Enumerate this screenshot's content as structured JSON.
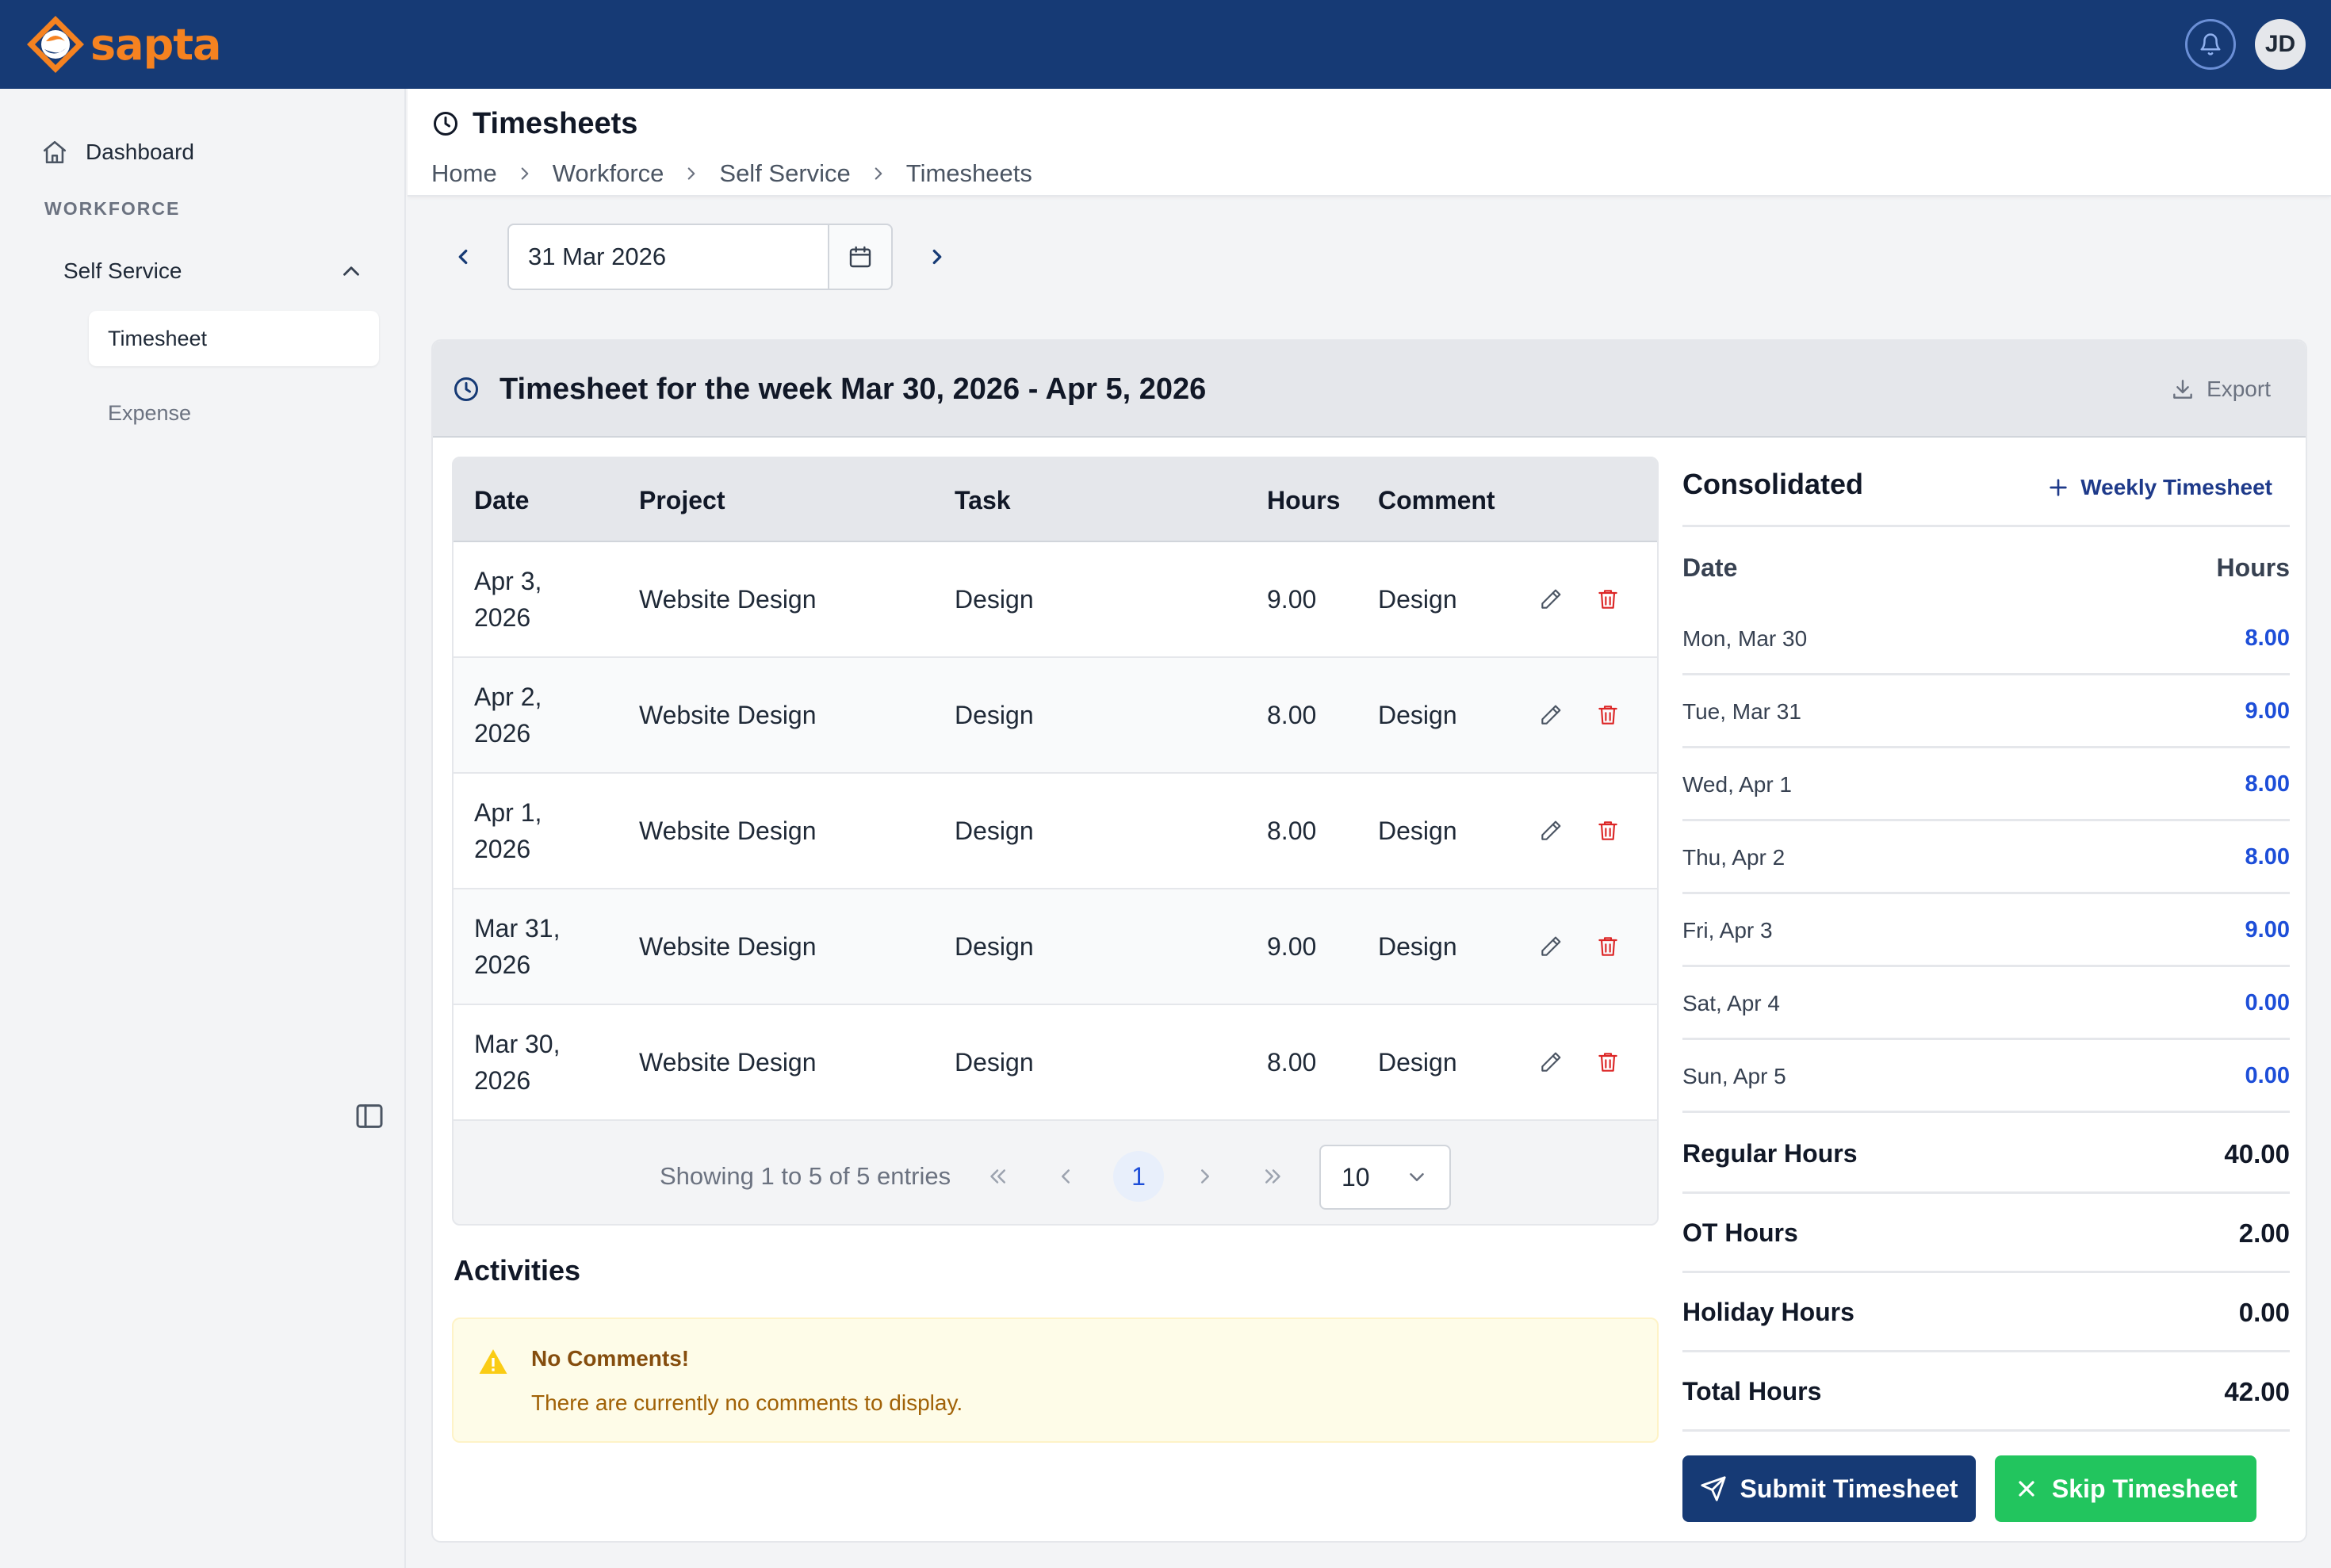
{
  "app": {
    "brand": "sapta",
    "user_initials": "JD"
  },
  "colors": {
    "topbar": "#163a75",
    "brand_orange": "#f58220",
    "link_blue": "#1d4ed8",
    "submit": "#163a75",
    "skip": "#22c55e",
    "danger": "#dc2626"
  },
  "sidebar": {
    "dashboard_label": "Dashboard",
    "section_label": "WORKFORCE",
    "group_label": "Self Service",
    "items": [
      {
        "label": "Timesheet",
        "active": true
      },
      {
        "label": "Expense",
        "active": false
      }
    ]
  },
  "header": {
    "title": "Timesheets",
    "breadcrumb": [
      "Home",
      "Workforce",
      "Self Service",
      "Timesheets"
    ]
  },
  "date_nav": {
    "value": "31 Mar 2026"
  },
  "card": {
    "title": "Timesheet for the week Mar 30, 2026 - Apr 5, 2026",
    "export_label": "Export"
  },
  "table": {
    "columns": [
      "Date",
      "Project",
      "Task",
      "Hours",
      "Comment"
    ],
    "rows": [
      {
        "date_line1": "Apr 3,",
        "date_line2": "2026",
        "project": "Website Design",
        "task": "Design",
        "hours": "9.00",
        "comment": "Design"
      },
      {
        "date_line1": "Apr 2,",
        "date_line2": "2026",
        "project": "Website Design",
        "task": "Design",
        "hours": "8.00",
        "comment": "Design"
      },
      {
        "date_line1": "Apr 1,",
        "date_line2": "2026",
        "project": "Website Design",
        "task": "Design",
        "hours": "8.00",
        "comment": "Design"
      },
      {
        "date_line1": "Mar 31,",
        "date_line2": "2026",
        "project": "Website Design",
        "task": "Design",
        "hours": "9.00",
        "comment": "Design"
      },
      {
        "date_line1": "Mar 30,",
        "date_line2": "2026",
        "project": "Website Design",
        "task": "Design",
        "hours": "8.00",
        "comment": "Design"
      }
    ],
    "pagination": {
      "summary": "Showing 1 to 5 of 5 entries",
      "current_page": "1",
      "page_size": "10"
    }
  },
  "activities": {
    "title": "Activities",
    "alert_title": "No Comments!",
    "alert_message": "There are currently no comments to display."
  },
  "consolidated": {
    "title": "Consolidated",
    "weekly_label": "Weekly Timesheet",
    "col_date": "Date",
    "col_hours": "Hours",
    "days": [
      {
        "day": "Mon, Mar 30",
        "hours": "8.00"
      },
      {
        "day": "Tue, Mar 31",
        "hours": "9.00"
      },
      {
        "day": "Wed, Apr 1",
        "hours": "8.00"
      },
      {
        "day": "Thu, Apr 2",
        "hours": "8.00"
      },
      {
        "day": "Fri, Apr 3",
        "hours": "9.00"
      },
      {
        "day": "Sat, Apr 4",
        "hours": "0.00"
      },
      {
        "day": "Sun, Apr 5",
        "hours": "0.00"
      }
    ],
    "totals": [
      {
        "label": "Regular Hours",
        "value": "40.00"
      },
      {
        "label": "OT Hours",
        "value": "2.00"
      },
      {
        "label": "Holiday Hours",
        "value": "0.00"
      },
      {
        "label": "Total Hours",
        "value": "42.00"
      }
    ]
  },
  "actions": {
    "submit_label": "Submit Timesheet",
    "skip_label": "Skip Timesheet"
  },
  "icons": [
    "logo-icon",
    "bell-icon",
    "home-icon",
    "chevron-up-icon",
    "sidebar-toggle-icon",
    "clock-icon",
    "chevron-right-icon",
    "chevron-left-icon",
    "calendar-icon",
    "download-icon",
    "edit-icon",
    "trash-icon",
    "double-chevron-left-icon",
    "double-chevron-right-icon",
    "chevron-down-icon",
    "warning-icon",
    "plus-icon",
    "send-icon",
    "close-icon"
  ]
}
